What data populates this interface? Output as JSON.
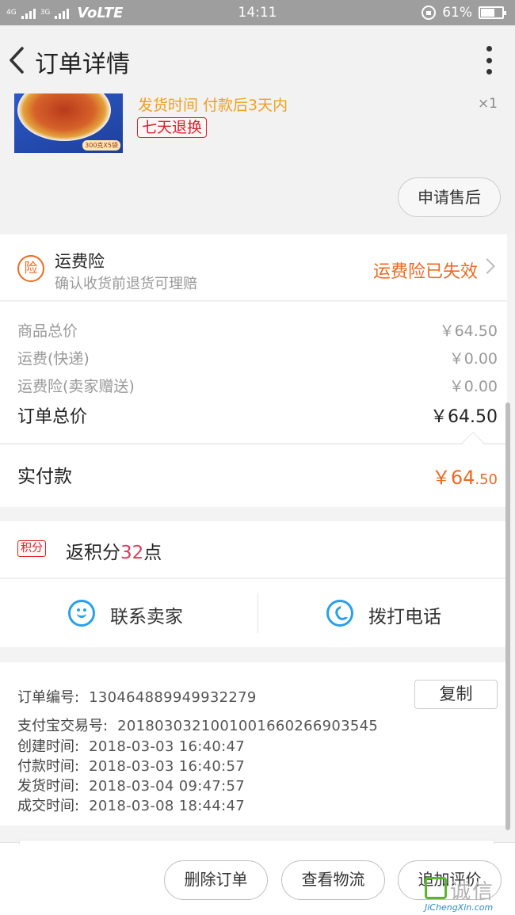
{
  "status_bar": {
    "signal_1": "4G",
    "signal_2": "3G",
    "network": "VoLTE",
    "time": "14:11",
    "battery_percent": "61%",
    "battery_level": 0.61,
    "icons": [
      "signal-icon",
      "rotation-lock-icon",
      "battery-icon"
    ]
  },
  "header": {
    "title": "订单详情",
    "back_icon": "chevron-left-icon",
    "more_icon": "more-vertical-icon"
  },
  "product": {
    "image_tag": "300克X5袋",
    "ship_time": "发货时间 付款后3天内",
    "return_badge": "七天退换",
    "quantity": "×1",
    "after_sales_button": "申请售后"
  },
  "freight_insurance": {
    "icon_text": "险",
    "name": "运费险",
    "description": "确认收货前退货可理赔",
    "status": "运费险已失效"
  },
  "price_breakdown": {
    "rows": [
      {
        "label": "商品总价",
        "value": "￥64.50"
      },
      {
        "label": "运费(快递)",
        "value": "￥0.00"
      },
      {
        "label": "运费险(卖家赠送)",
        "value": "￥0.00"
      }
    ],
    "total_label": "订单总价",
    "total_value": "￥64.50"
  },
  "payment": {
    "label": "实付款",
    "currency": "￥",
    "amount_int": "64",
    "amount_dec": ".50"
  },
  "points": {
    "tag": "积分",
    "prefix": "返积分",
    "number": "32",
    "suffix": "点"
  },
  "contact": {
    "seller_label": "联系卖家",
    "phone_label": "拨打电话"
  },
  "order_info": {
    "copy_button": "复制",
    "rows": [
      {
        "label": "订单编号:",
        "value": "130464889949932279"
      },
      {
        "label": "支付宝交易号:",
        "value": "2018030321001001660266903545"
      },
      {
        "label": "创建时间:",
        "value": "2018-03-03 16:40:47"
      },
      {
        "label": "付款时间:",
        "value": "2018-03-03 16:40:57"
      },
      {
        "label": "发货时间:",
        "value": "2018-03-04 09:47:57"
      },
      {
        "label": "成交时间:",
        "value": "2018-03-08 18:44:47"
      }
    ]
  },
  "bottom_actions": {
    "delete": "删除订单",
    "logistics": "查看物流",
    "review": "追加评价"
  },
  "watermark": {
    "cn": "诚信",
    "en": "JiChengXin.com"
  },
  "colors": {
    "accent_orange": "#ec6a21",
    "ship_yellow": "#f0a01e",
    "badge_red": "#d6232e",
    "icon_blue": "#2aa0e8"
  }
}
